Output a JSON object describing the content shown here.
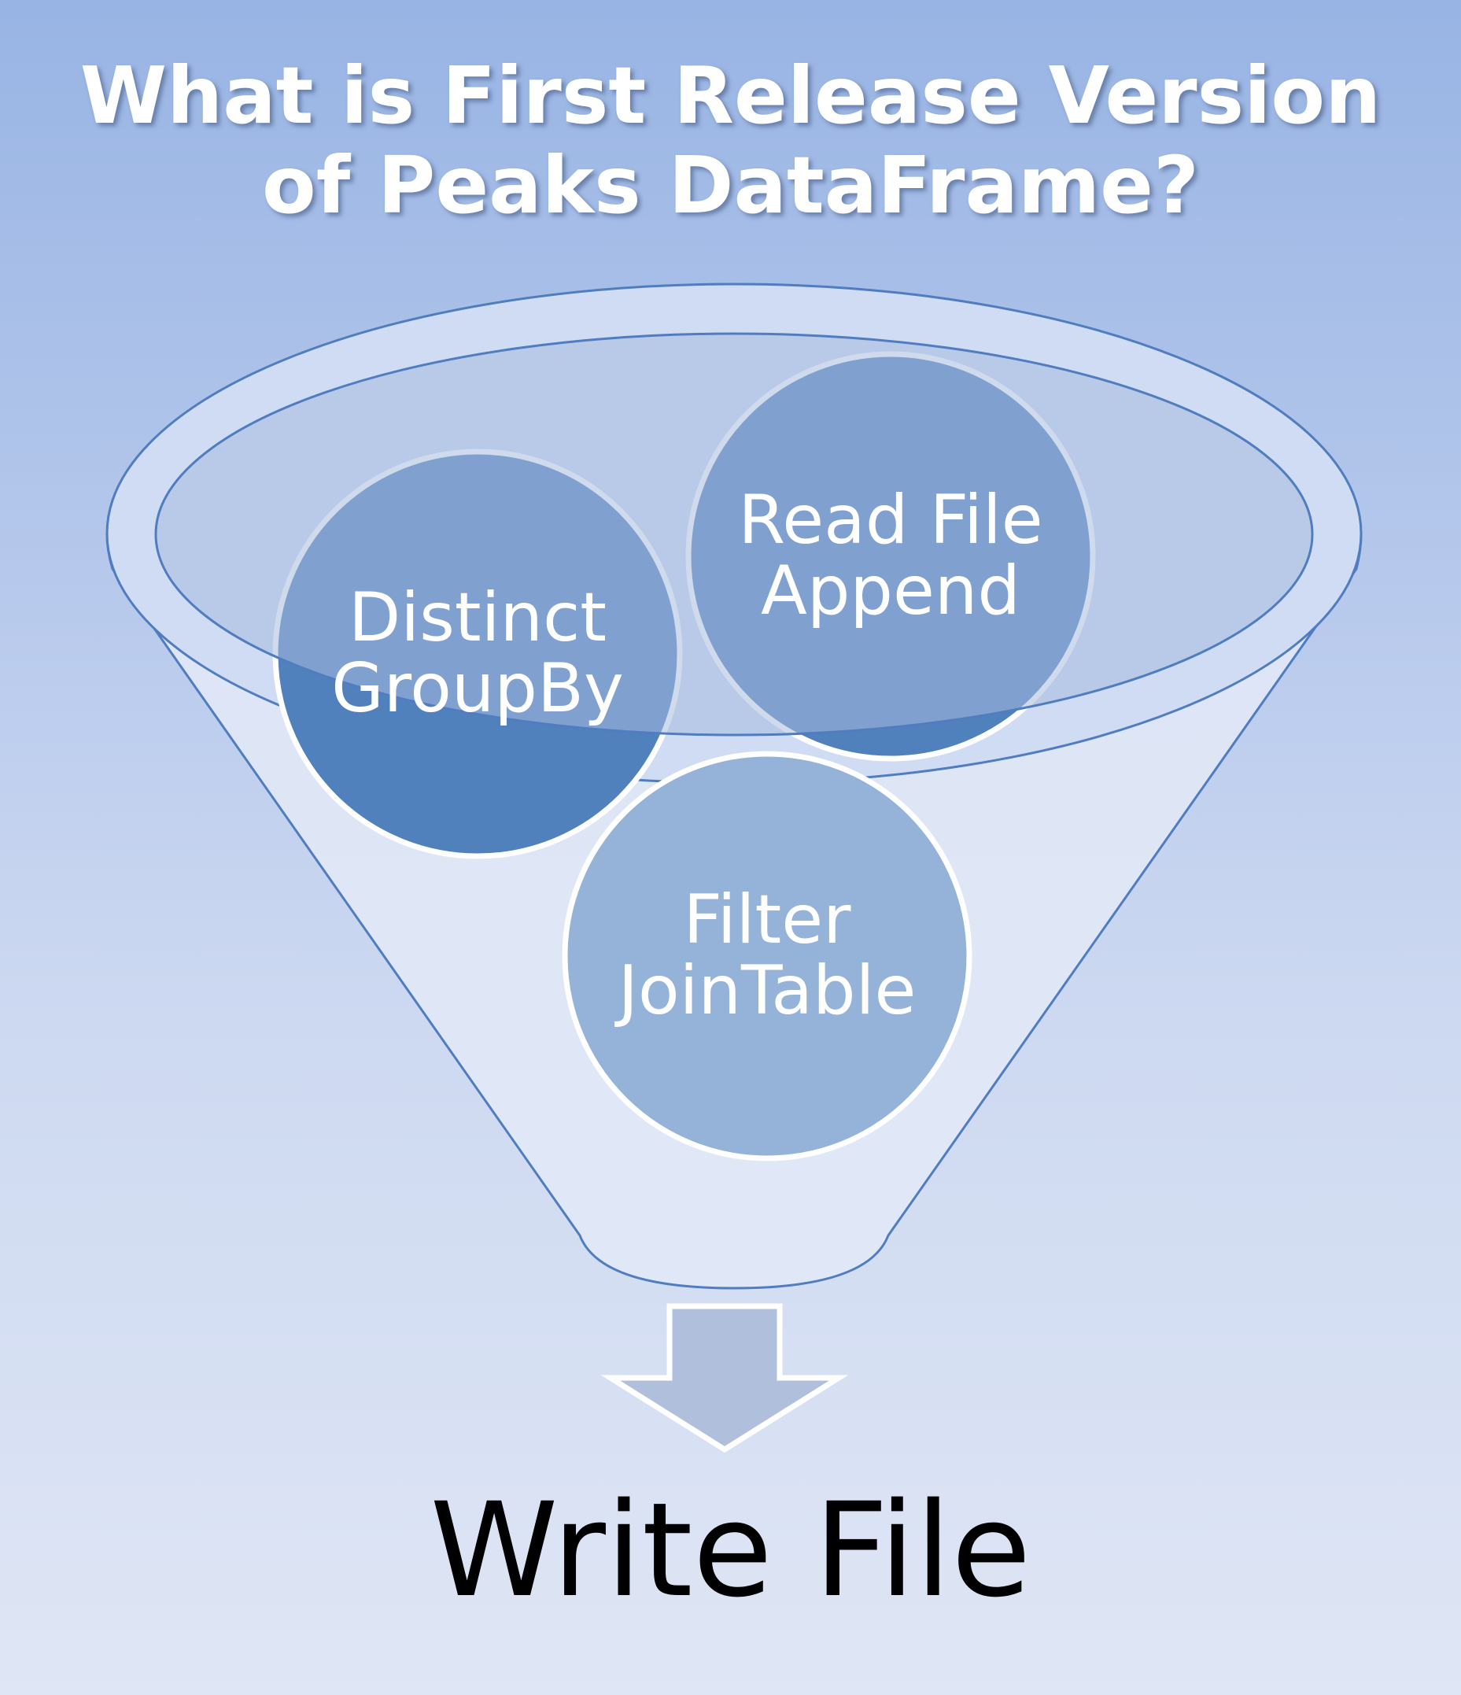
{
  "title": {
    "line1": "What is First Release Version",
    "line2": "of Peaks DataFrame?"
  },
  "funnel": {
    "items": [
      {
        "line1": "Distinct",
        "line2": "GroupBy"
      },
      {
        "line1": "Read File",
        "line2": "Append"
      },
      {
        "line1": "Filter",
        "line2": "JoinTable"
      }
    ]
  },
  "output": {
    "label": "Write File"
  },
  "colors": {
    "dark_circle": "#5081bd",
    "light_circle": "#95b2d9",
    "funnel_body": "#e1e8f6",
    "funnel_outline": "#4f7dbf",
    "arrow_fill": "#b0c0dc"
  }
}
